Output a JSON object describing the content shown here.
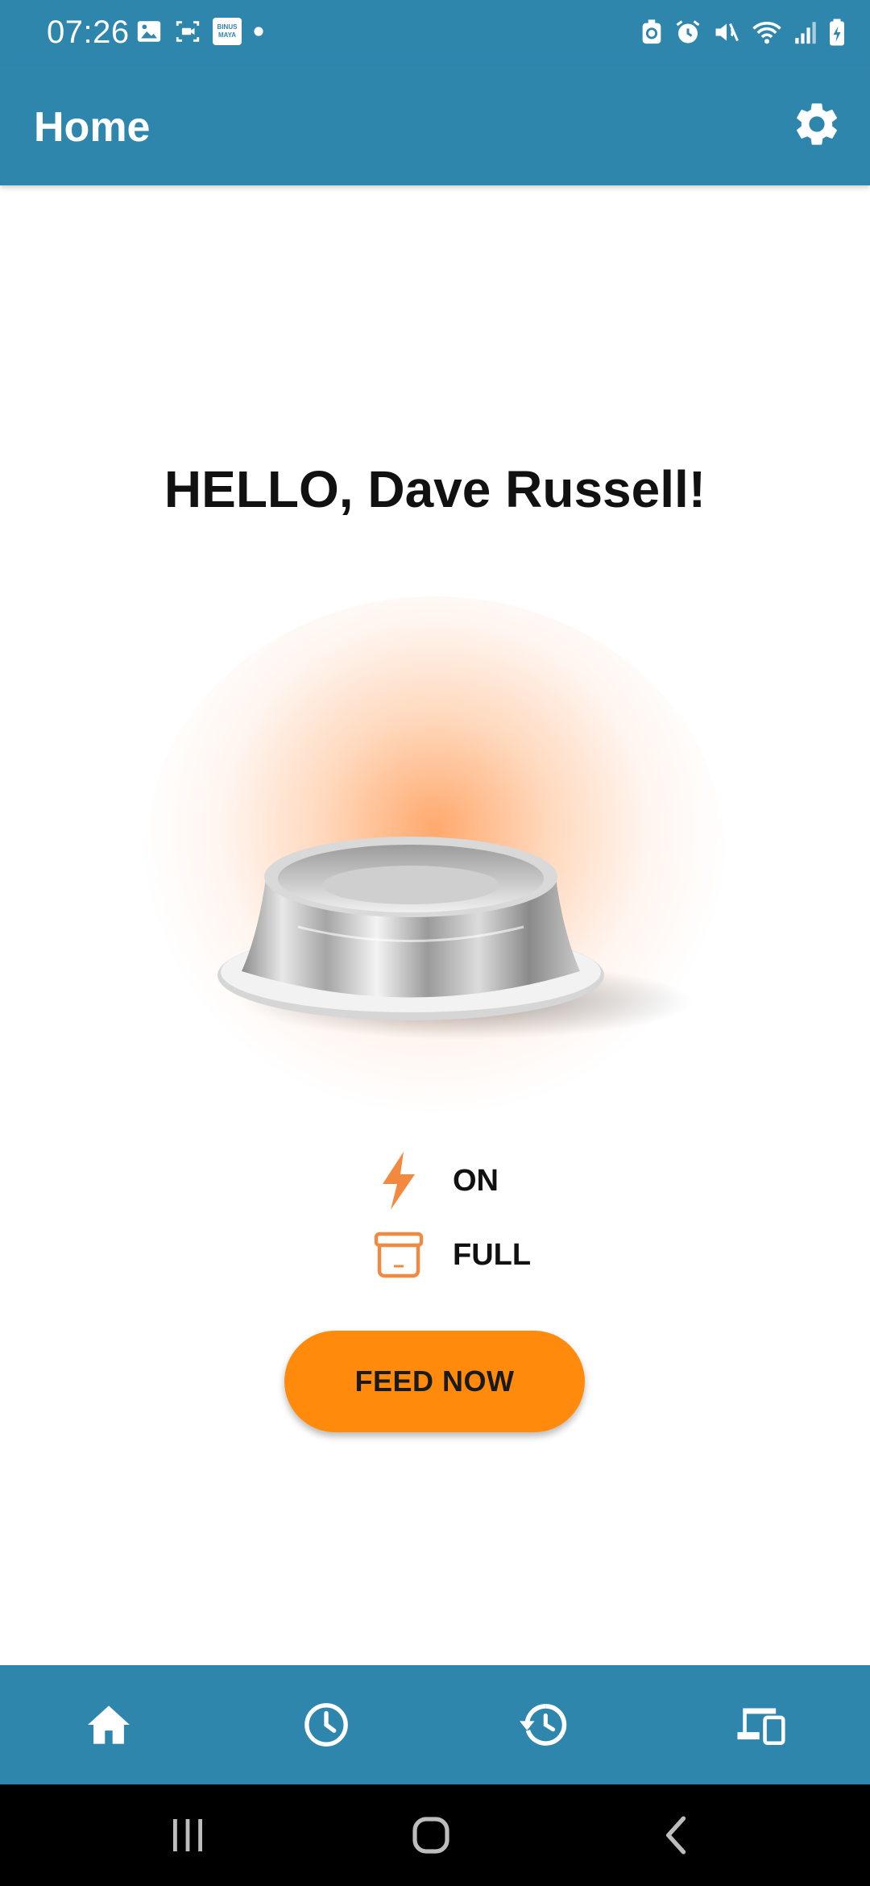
{
  "status_bar": {
    "time": "07:26",
    "left_icons": [
      "image-icon",
      "screen-record-icon",
      "binus-maya-icon",
      "dot-icon"
    ],
    "right_icons": [
      "recycle-icon",
      "alarm-icon",
      "mute-icon",
      "wifi-icon",
      "signal-icon",
      "battery-charging-icon"
    ],
    "app_badge_text": "BINUS MAYA"
  },
  "appbar": {
    "title": "Home",
    "settings_icon": "gear-icon"
  },
  "main": {
    "greeting": "HELLO, Dave Russell!",
    "bowl_image": "stainless-bowl-image",
    "power_status": {
      "icon": "lightning-bolt-icon",
      "label": "ON"
    },
    "food_status": {
      "icon": "container-box-icon",
      "label": "FULL"
    },
    "feed_button": "FEED NOW"
  },
  "bottom_nav": {
    "items": [
      {
        "name": "home",
        "icon": "home-icon",
        "active": true
      },
      {
        "name": "schedule",
        "icon": "clock-icon",
        "active": false
      },
      {
        "name": "history",
        "icon": "history-icon",
        "active": false
      },
      {
        "name": "devices",
        "icon": "devices-icon",
        "active": false
      }
    ]
  },
  "colors": {
    "primary": "#2f86ad",
    "accent": "#ff8a0c",
    "icon_accent": "#f2893f",
    "text": "#111111"
  }
}
